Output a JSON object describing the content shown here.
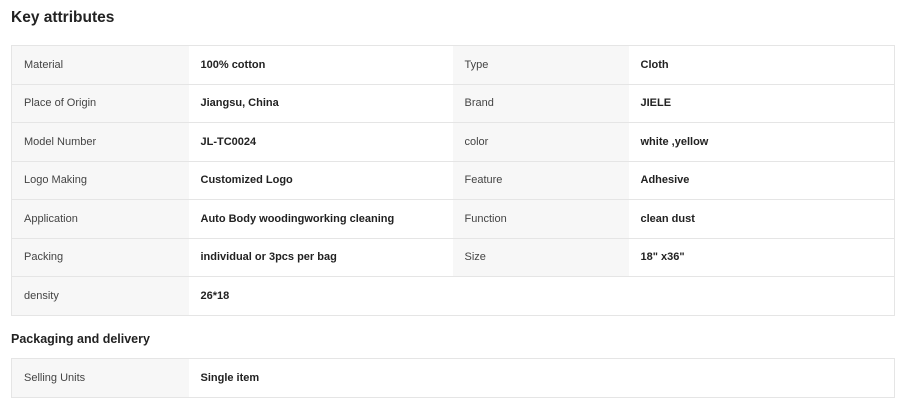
{
  "key_attributes": {
    "title": "Key attributes",
    "rows": [
      [
        {
          "k": "Material",
          "v": "100% cotton"
        },
        {
          "k": "Type",
          "v": "Cloth"
        }
      ],
      [
        {
          "k": "Place of Origin",
          "v": "Jiangsu, China"
        },
        {
          "k": "Brand",
          "v": "JIELE"
        }
      ],
      [
        {
          "k": "Model Number",
          "v": "JL-TC0024"
        },
        {
          "k": "color",
          "v": "white ,yellow"
        }
      ],
      [
        {
          "k": "Logo Making",
          "v": "Customized Logo"
        },
        {
          "k": "Feature",
          "v": "Adhesive"
        }
      ],
      [
        {
          "k": "Application",
          "v": "Auto Body woodingworking cleaning"
        },
        {
          "k": "Function",
          "v": "clean dust"
        }
      ],
      [
        {
          "k": "Packing",
          "v": "individual or 3pcs per bag"
        },
        {
          "k": "Size",
          "v": "18\" x36\""
        }
      ],
      [
        {
          "k": "density",
          "v": "26*18"
        }
      ]
    ]
  },
  "packaging_delivery": {
    "title": "Packaging and delivery",
    "rows": [
      [
        {
          "k": "Selling Units",
          "v": "Single item"
        }
      ]
    ]
  }
}
